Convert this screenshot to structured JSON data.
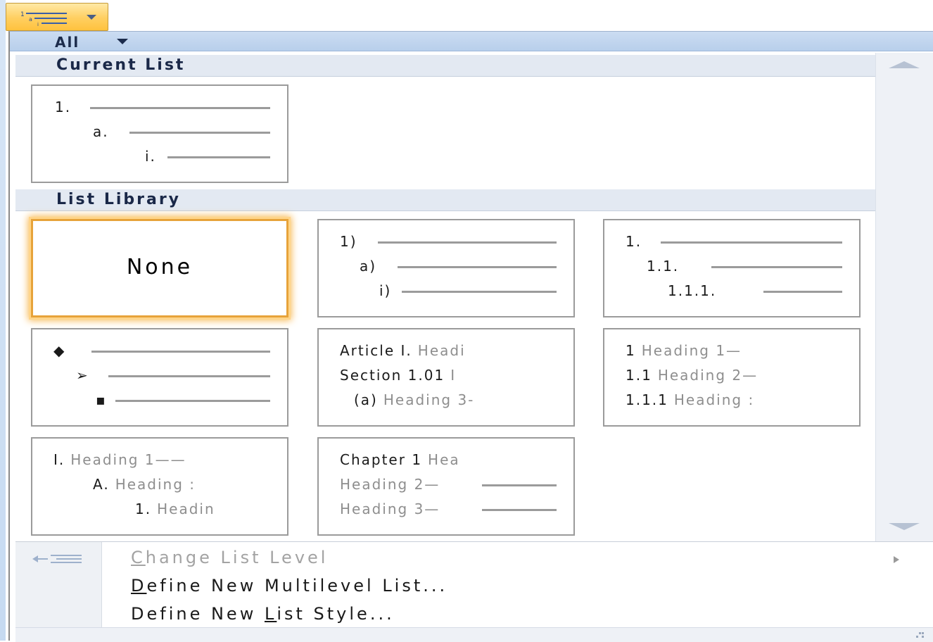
{
  "filter": {
    "label": "All"
  },
  "sections": {
    "current": "Current List",
    "library": "List Library"
  },
  "current_list": {
    "rows": [
      "1.",
      "a.",
      "i."
    ]
  },
  "library": {
    "none_label": "None",
    "tile_paren": {
      "rows": [
        "1)",
        "a)",
        "i)"
      ]
    },
    "tile_decimal": {
      "rows": [
        "1.",
        "1.1.",
        "1.1.1."
      ]
    },
    "tile_bullets": {
      "rows": [
        "◆",
        "➢",
        "▪"
      ]
    },
    "tile_article": {
      "rows": [
        {
          "main": "Article I.",
          "sub": "Headi"
        },
        {
          "main": "Section 1.01",
          "sub": "I"
        },
        {
          "main": "(a)",
          "sub": "Heading 3-"
        }
      ]
    },
    "tile_heading_num": {
      "rows": [
        {
          "main": "1",
          "sub": "Heading 1—"
        },
        {
          "main": "1.1",
          "sub": "Heading 2—"
        },
        {
          "main": "1.1.1",
          "sub": "Heading :"
        }
      ]
    },
    "tile_roman": {
      "rows": [
        {
          "main": "I.",
          "sub": "Heading 1——"
        },
        {
          "main": "A.",
          "sub": "Heading :"
        },
        {
          "main": "1.",
          "sub": "Headin"
        }
      ]
    },
    "tile_chapter": {
      "rows": [
        {
          "main": "Chapter 1",
          "sub": "Hea"
        },
        {
          "main": "",
          "sub": "Heading 2—"
        },
        {
          "main": "",
          "sub": "Heading 3—"
        }
      ]
    }
  },
  "menu": {
    "change_level": {
      "first": "C",
      "rest": "hange List Level"
    },
    "define_multilevel": {
      "first": "D",
      "rest": "efine New Multilevel List..."
    },
    "define_style": {
      "pre": "Define New ",
      "key": "L",
      "rest": "ist Style..."
    }
  },
  "colors": {
    "selection": "#e7a33a",
    "filter_bar": "#c4d7ef",
    "ribbon_button": "#ffd066"
  },
  "icons": {
    "ribbon": "multilevel-list-icon",
    "level": "change-list-level-icon"
  }
}
